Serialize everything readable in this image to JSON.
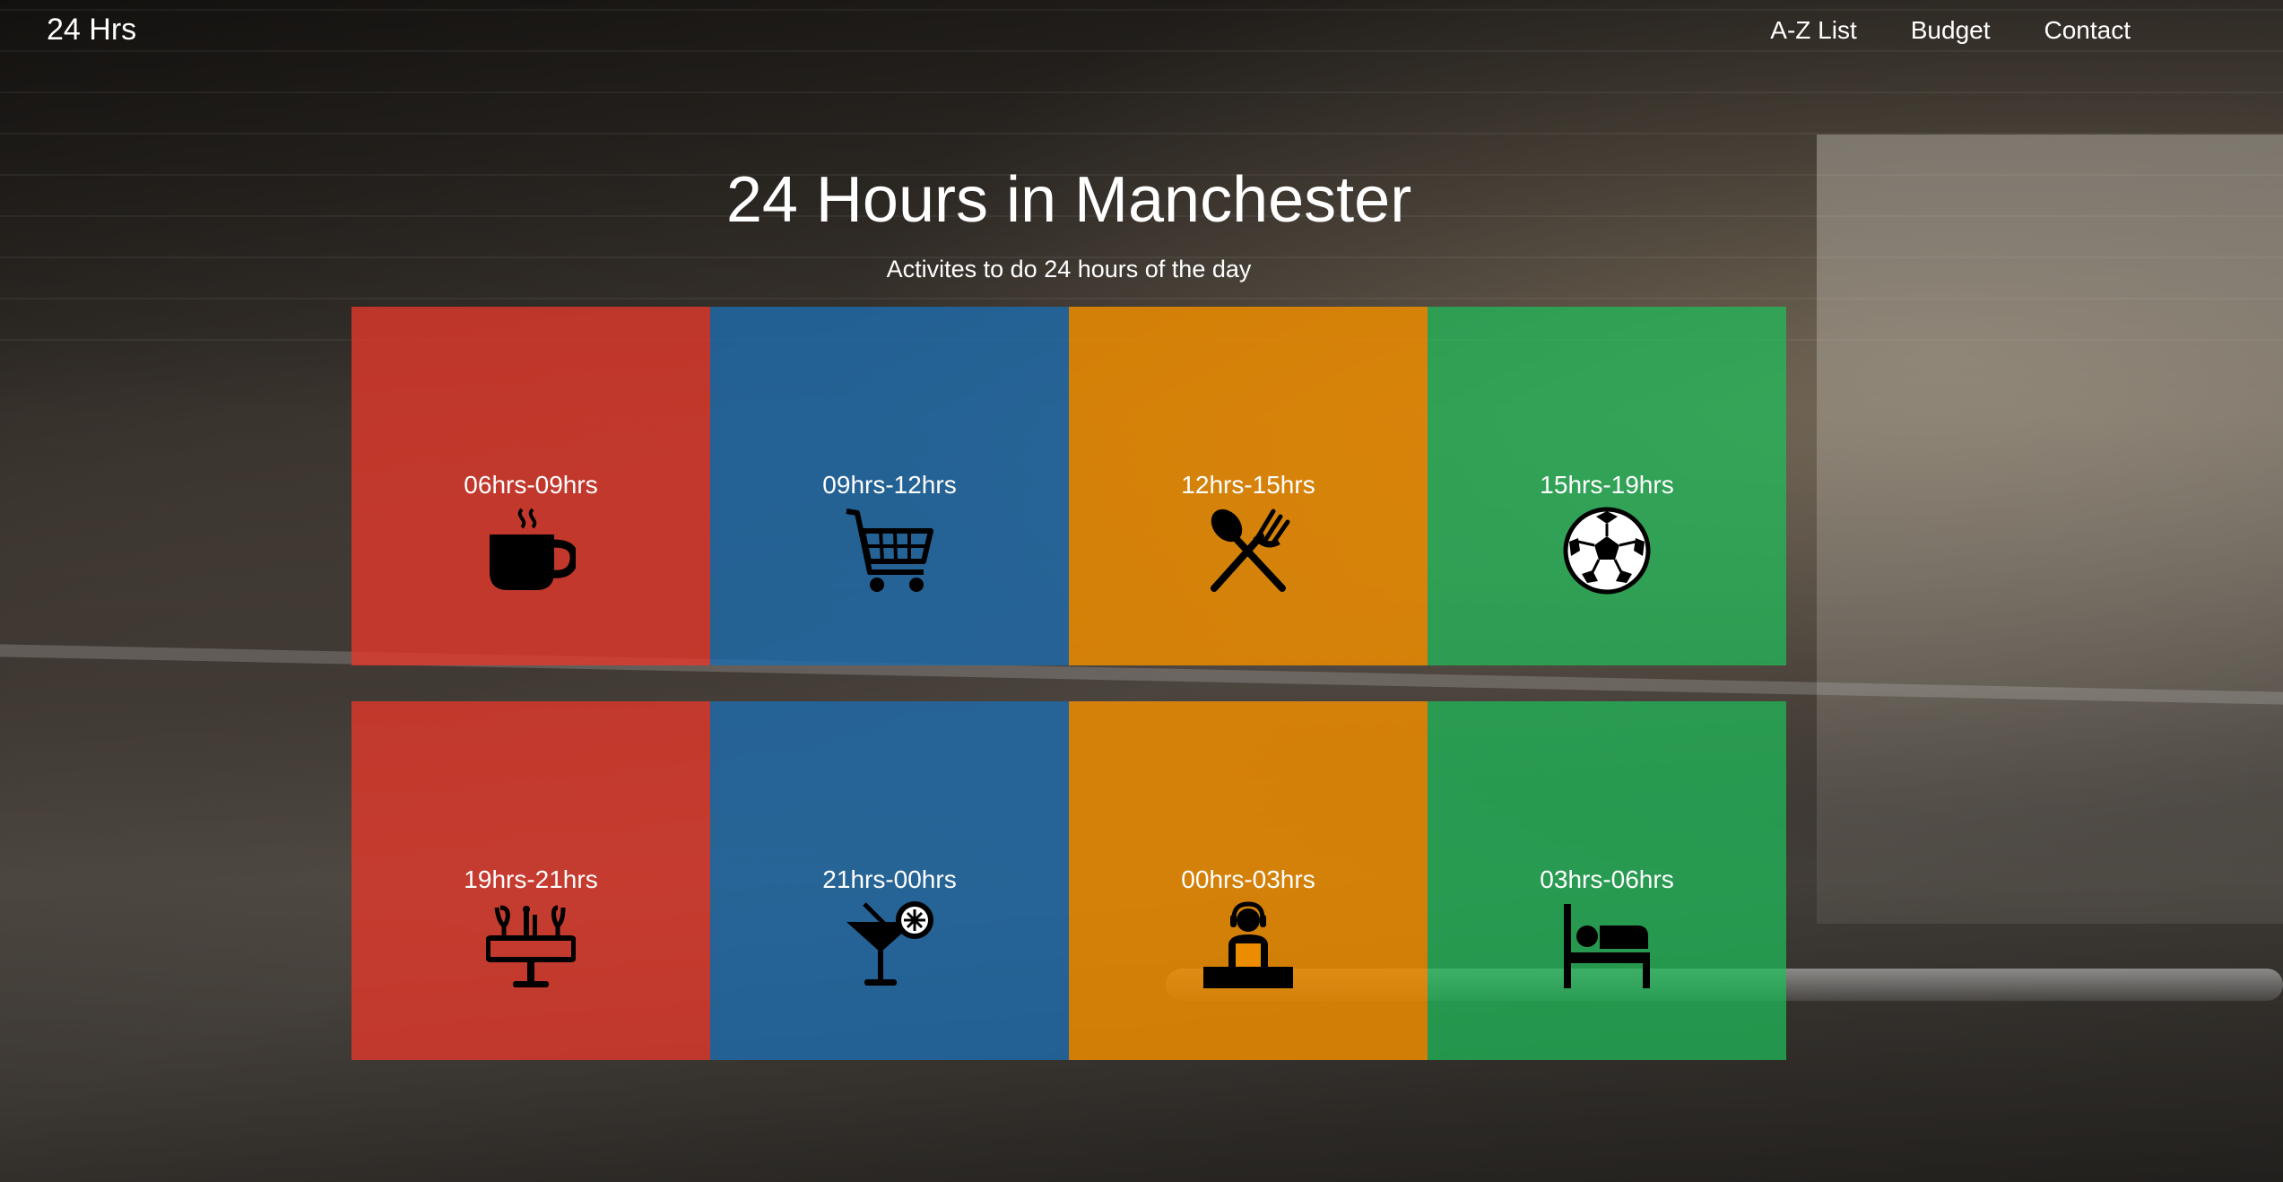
{
  "navbar": {
    "brand": "24 Hrs",
    "links": [
      "A-Z List",
      "Budget",
      "Contact"
    ]
  },
  "hero": {
    "title": "24 Hours in Manchester",
    "subtitle": "Activites to do 24 hours of the day"
  },
  "tiles": [
    {
      "label": "06hrs-09hrs",
      "icon": "coffee-cup-icon",
      "color": "#e2382b"
    },
    {
      "label": "09hrs-12hrs",
      "icon": "shopping-cart-icon",
      "color": "#1e6aaa"
    },
    {
      "label": "12hrs-15hrs",
      "icon": "spoon-fork-icon",
      "color": "#ec8c00"
    },
    {
      "label": "15hrs-19hrs",
      "icon": "football-icon",
      "color": "#1ebe5a"
    },
    {
      "label": "19hrs-21hrs",
      "icon": "dining-table-icon",
      "color": "#e2382b"
    },
    {
      "label": "21hrs-00hrs",
      "icon": "cocktail-icon",
      "color": "#1e6aaa"
    },
    {
      "label": "00hrs-03hrs",
      "icon": "dj-icon",
      "color": "#ec8c00"
    },
    {
      "label": "03hrs-06hrs",
      "icon": "bed-icon",
      "color": "#1ebe5a"
    }
  ]
}
